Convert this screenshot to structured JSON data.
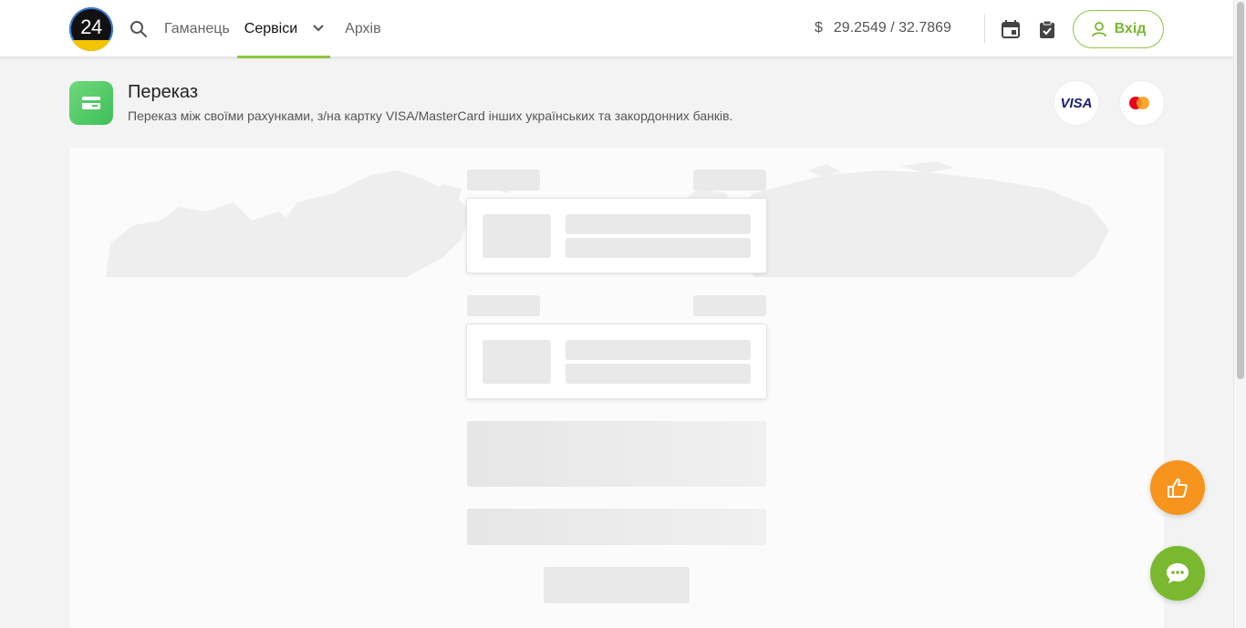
{
  "header": {
    "logo_text": "24",
    "nav": {
      "wallet": "Гаманець",
      "services": "Сервіси",
      "archive": "Архів"
    },
    "rate": {
      "currency_symbol": "$",
      "value": "29.2549 / 32.7869"
    },
    "login_label": "Вхід"
  },
  "page": {
    "title": "Переказ",
    "subtitle": "Переказ між своїми рахунками, з/на картку VISA/MasterCard інших українських та закордонних банків.",
    "visa_label": "VISA"
  },
  "icons": {
    "search": "search-icon",
    "calendar": "calendar-icon",
    "clipboard": "clipboard-check-icon",
    "user": "user-icon",
    "card": "credit-card-icon",
    "like": "thumbs-up-icon",
    "chat": "chat-icon"
  },
  "colors": {
    "accent_green": "#8dc63f",
    "login_green": "#7ab830",
    "like_orange": "#f7941d",
    "chat_green": "#7ab830",
    "service_green": "#4cc866"
  }
}
